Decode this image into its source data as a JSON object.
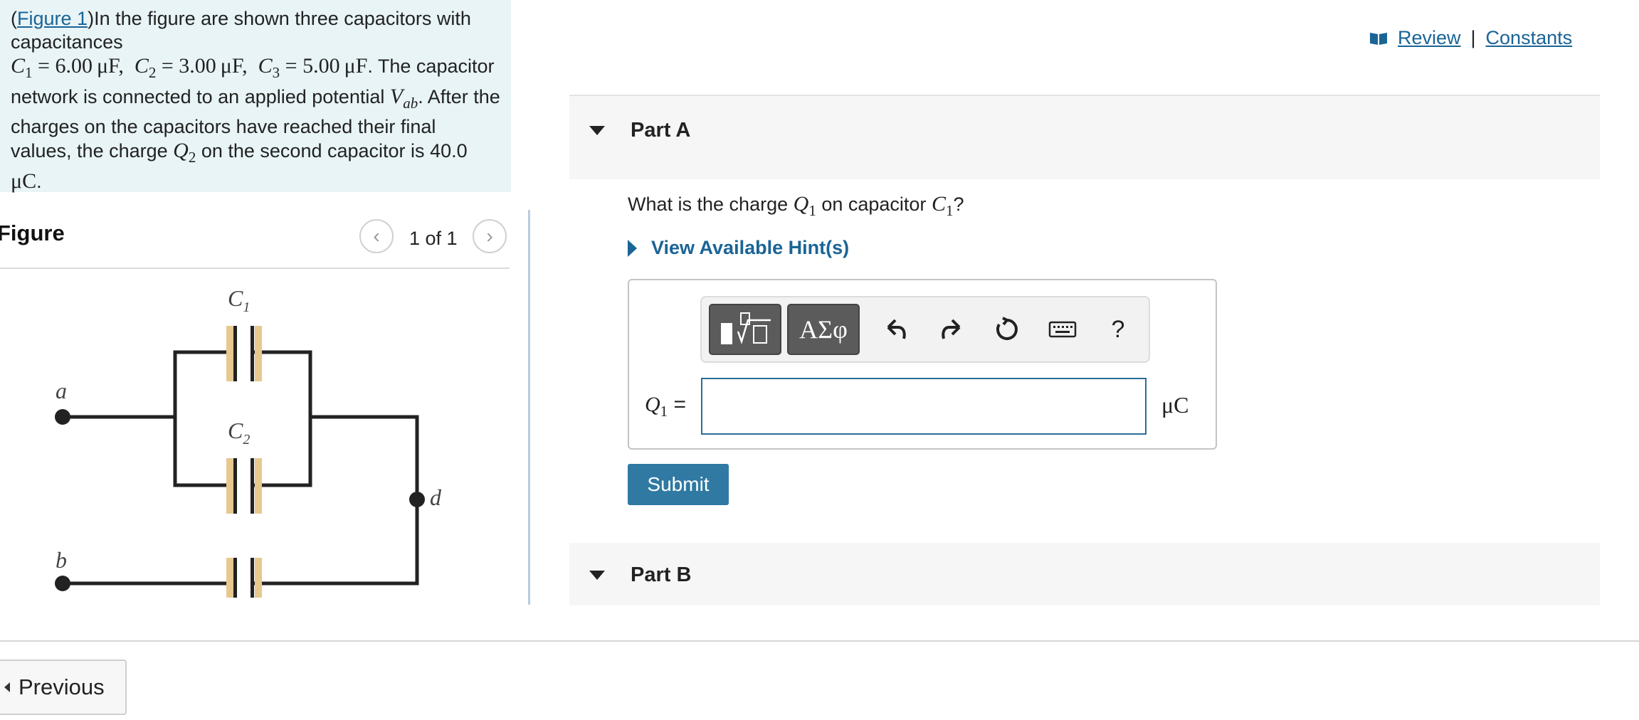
{
  "problem": {
    "figure_link": "Figure 1",
    "text_1": "In the figure are shown three capacitors with capacitances",
    "c1_value": "6.00",
    "c2_value": "3.00",
    "c3_value": "5.00",
    "cap_unit": "μF",
    "text_2": ". The capacitor network is connected to an applied potential",
    "text_3": ". After the charges on the capacitors have reached their final values, the charge",
    "text_4": "on the second capacitor is",
    "q2_value": "40.0",
    "charge_unit": "μC"
  },
  "figure": {
    "title": "Figure",
    "pager": "1 of 1",
    "labels": {
      "c1": "C",
      "c1_sub": "1",
      "c2": "C",
      "c2_sub": "2",
      "a": "a",
      "b": "b",
      "d": "d"
    },
    "colors": {
      "plate_fill": "#e7c88f",
      "wire": "#222222"
    }
  },
  "header": {
    "review": "Review",
    "separator": "|",
    "constants": "Constants"
  },
  "partA": {
    "label": "Part A",
    "question_pre": "What is the charge",
    "question_mid": "on capacitor",
    "question_post": "?",
    "hint_label": "View Available Hint(s)",
    "toolbar": {
      "symbols": "ΑΣφ",
      "help": "?"
    },
    "answer_var": "Q",
    "answer_sub": "1",
    "equals": "=",
    "unit": "μC",
    "answer_value": "",
    "submit": "Submit"
  },
  "partB": {
    "label": "Part B"
  },
  "footer": {
    "previous": "Previous"
  },
  "colors": {
    "accent": "#1a6496",
    "submit_bg": "#2f79a3",
    "problem_bg": "#e8f4f6"
  }
}
